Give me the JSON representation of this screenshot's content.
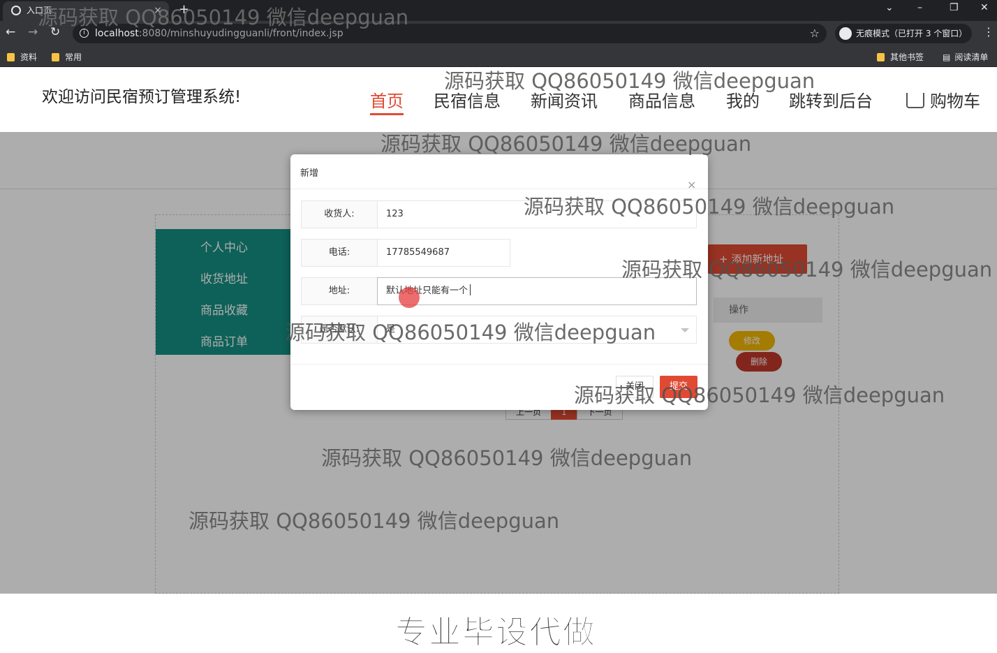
{
  "browser": {
    "tab_title": "入口页",
    "tab_close": "×",
    "new_tab": "+",
    "url_host": "localhost",
    "url_rest": ":8080/minshuyudingguanli/front/index.jsp",
    "incognito_label": "无痕模式（已打开 3 个窗口）",
    "bookmarks": [
      "资料",
      "常用"
    ],
    "bookmarks_right": [
      "其他书签",
      "阅读清单"
    ]
  },
  "header": {
    "site_title": "欢迎访问民宿预订管理系统!",
    "nav": [
      {
        "label": "首页",
        "active": true
      },
      {
        "label": "民宿信息"
      },
      {
        "label": "新闻资讯"
      },
      {
        "label": "商品信息"
      },
      {
        "label": "我的"
      },
      {
        "label": "跳转到后台"
      },
      {
        "label": "购物车"
      }
    ]
  },
  "sidebar": {
    "items": [
      "个人中心",
      "收货地址",
      "商品收藏",
      "商品订单"
    ]
  },
  "address_panel": {
    "add_button": "+ 添加新地址",
    "column_operation": "操作",
    "edit_button": "修改",
    "delete_button": "删除"
  },
  "pager": {
    "prev": "上一页",
    "current": "1",
    "next": "下一页"
  },
  "modal": {
    "title": "新增",
    "close_icon": "×",
    "fields": {
      "receiver_label": "收货人:",
      "receiver_value": "123",
      "phone_label": "电话:",
      "phone_value": "17785549687",
      "address_label": "地址:",
      "address_value": "默认地址只能有一个",
      "default_label": "是否默认:",
      "default_value": "是"
    },
    "close_button": "关闭",
    "submit_button": "提交"
  },
  "watermarks": {
    "text": "源码获取 QQ86050149 微信deepguan",
    "banner": "专业毕设代做"
  }
}
